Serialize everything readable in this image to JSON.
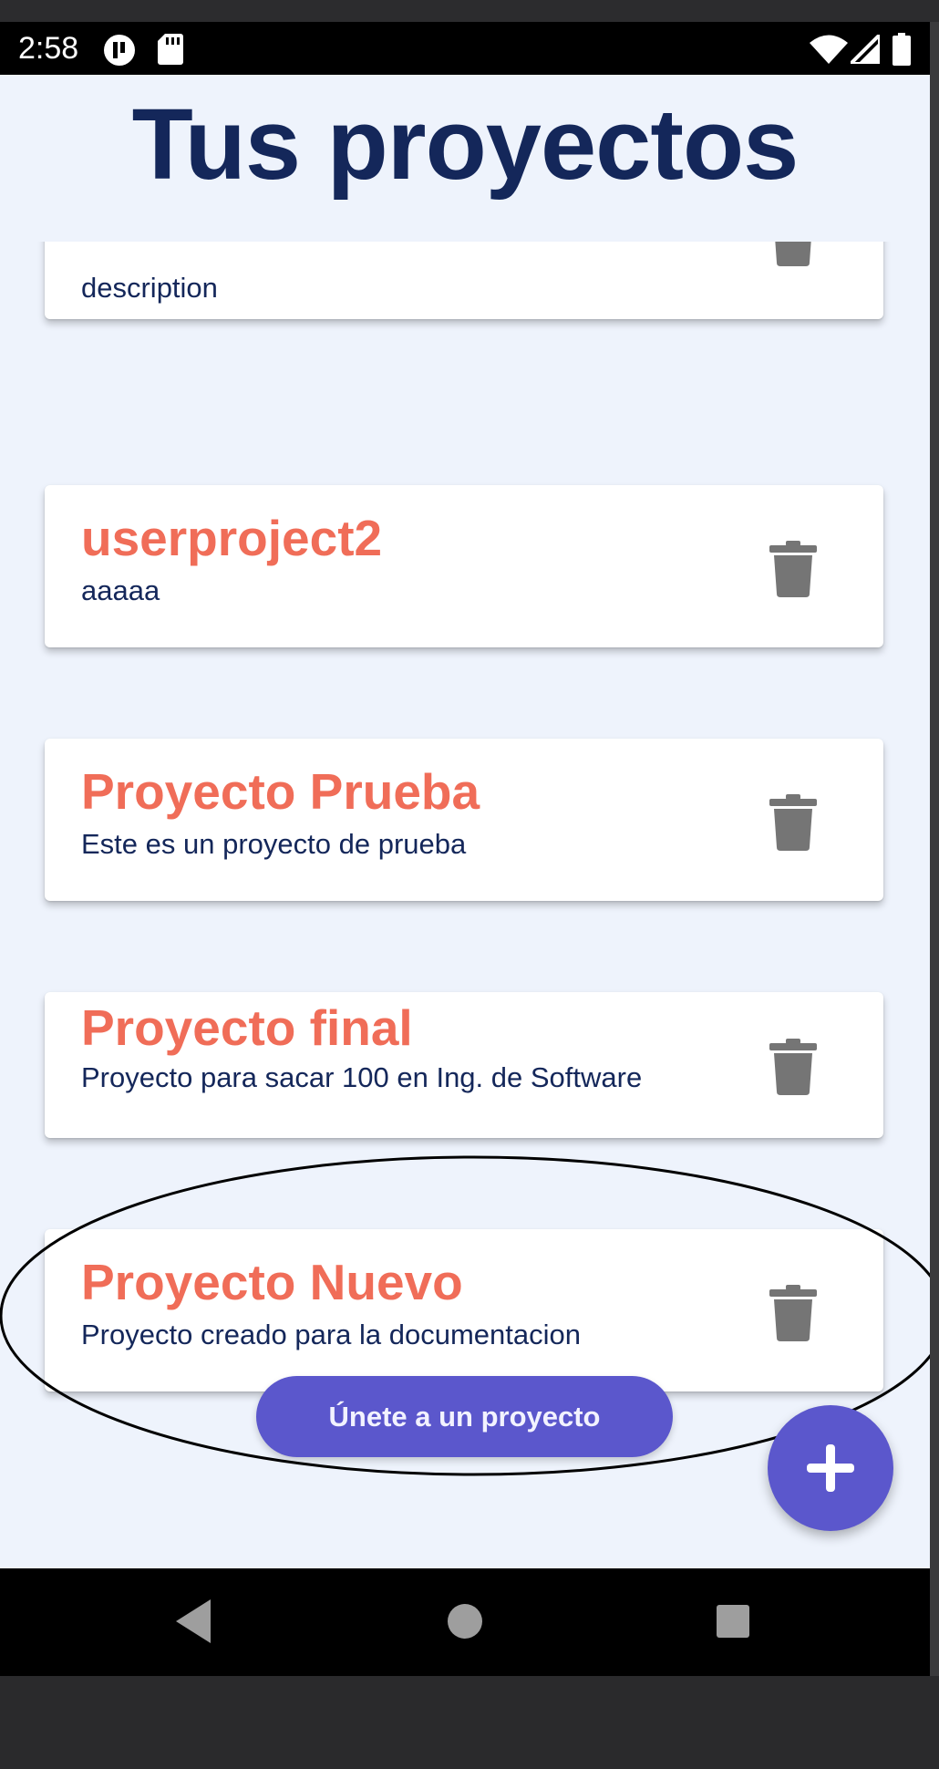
{
  "status_bar": {
    "time": "2:58",
    "left_icons": [
      "pause-badge-icon",
      "sd-card-icon"
    ],
    "right_icons": [
      "wifi-icon",
      "signal-icon",
      "battery-icon"
    ]
  },
  "header": {
    "title": "Tus proyectos"
  },
  "projects": [
    {
      "name": "",
      "description": "description"
    },
    {
      "name": "userproject2",
      "description": "aaaaa"
    },
    {
      "name": "Proyecto Prueba",
      "description": "Este es un proyecto de prueba"
    },
    {
      "name": "Proyecto final",
      "description": "Proyecto para sacar 100 en Ing. de Software"
    },
    {
      "name": "Proyecto Nuevo",
      "description": "Proyecto creado para la documentacion"
    }
  ],
  "card_delete_icon": "trash-icon",
  "join_button": {
    "label": "Únete a un proyecto"
  },
  "fab": {
    "icon": "plus-icon"
  },
  "nav_bar": {
    "icons": [
      "back-icon",
      "home-icon",
      "recents-icon"
    ]
  },
  "colors": {
    "title": "#14275a",
    "project_name": "#f06d58",
    "description": "#14275a",
    "accent": "#5b57cc",
    "background": "#eef3fc",
    "card": "#ffffff",
    "trash": "#757575"
  }
}
